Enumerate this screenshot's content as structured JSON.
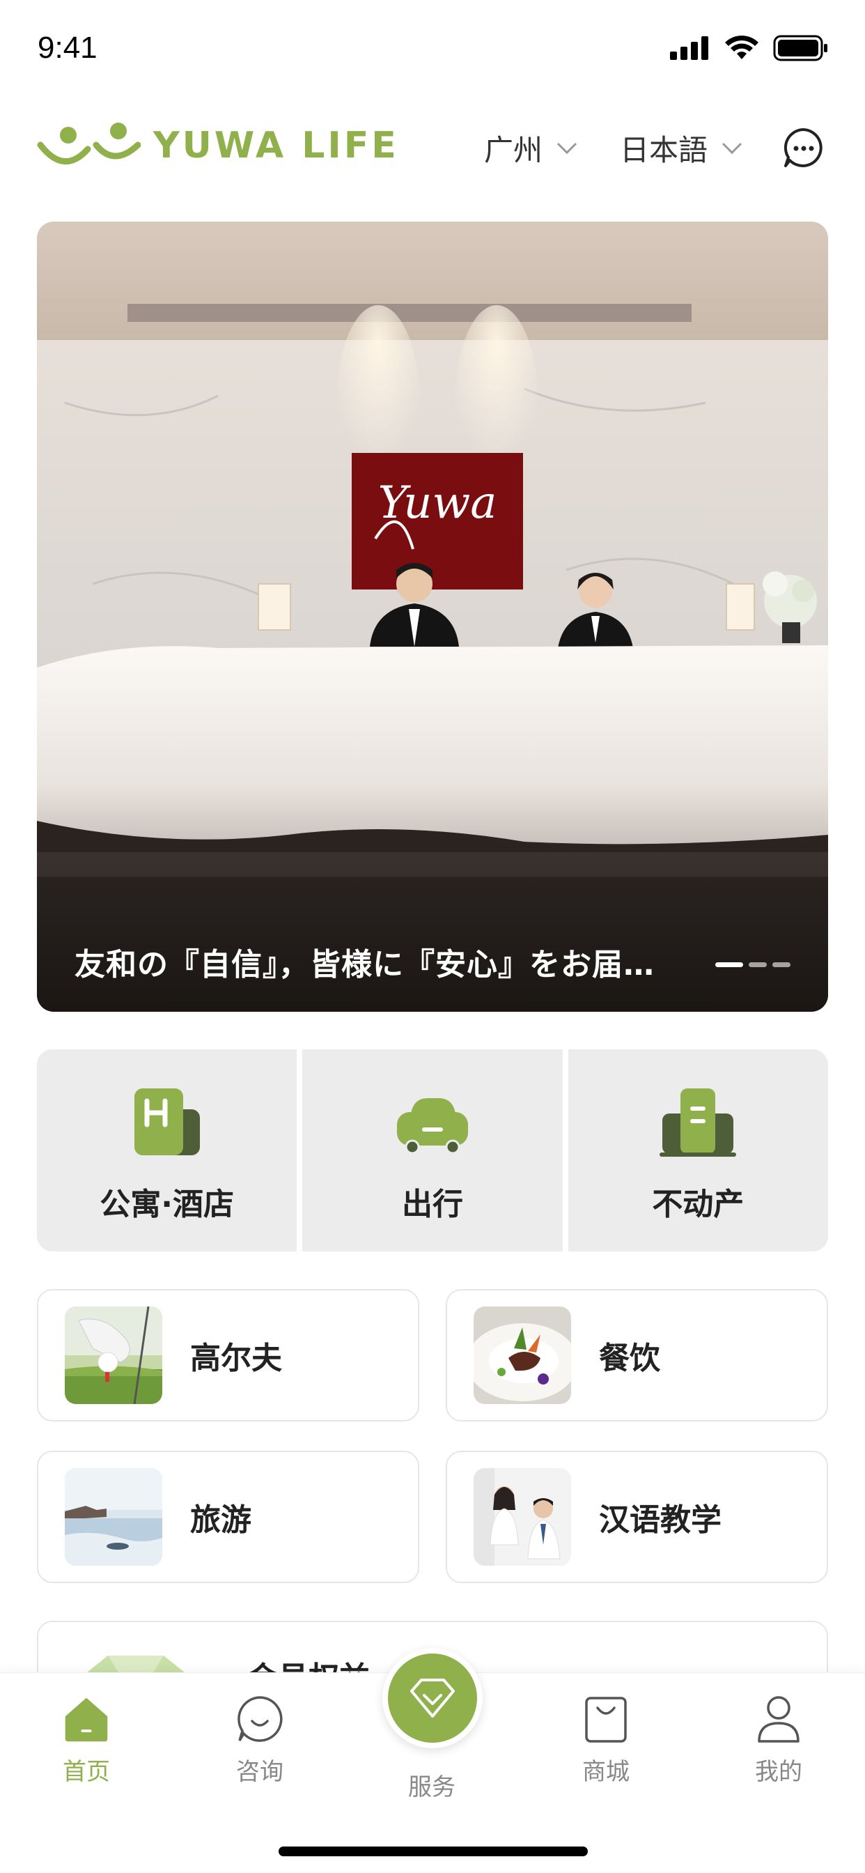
{
  "status_bar": {
    "time": "9:41"
  },
  "header": {
    "logo_text": "YUWA LIFE",
    "city": "广州",
    "language": "日本語"
  },
  "banner": {
    "caption": "友和の『自信』，皆様に『安心』をお届…",
    "sign_text": "Yuwa",
    "pages": 3,
    "active_page": 1
  },
  "primary_services": [
    {
      "label": "公寓·酒店",
      "icon": "hotel-icon"
    },
    {
      "label": "出行",
      "icon": "car-icon"
    },
    {
      "label": "不动产",
      "icon": "building-icon"
    }
  ],
  "categories": [
    {
      "label": "高尔夫",
      "thumb": "golf-photo"
    },
    {
      "label": "餐饮",
      "thumb": "dish-photo"
    },
    {
      "label": "旅游",
      "thumb": "beach-photo"
    },
    {
      "label": "汉语教学",
      "thumb": "teaching-photo"
    }
  ],
  "member": {
    "label": "会员权益"
  },
  "tabs": [
    {
      "label": "首页",
      "icon": "home-icon",
      "active": true
    },
    {
      "label": "咨询",
      "icon": "chat-bubble-icon",
      "active": false
    },
    {
      "label": "服务",
      "icon": "diamond-icon",
      "active": false
    },
    {
      "label": "商城",
      "icon": "shopping-bag-icon",
      "active": false
    },
    {
      "label": "我的",
      "icon": "user-icon",
      "active": false
    }
  ],
  "colors": {
    "brand_green": "#8fb04a",
    "dark_green": "#4e5e38",
    "inactive_gray": "#888888"
  }
}
